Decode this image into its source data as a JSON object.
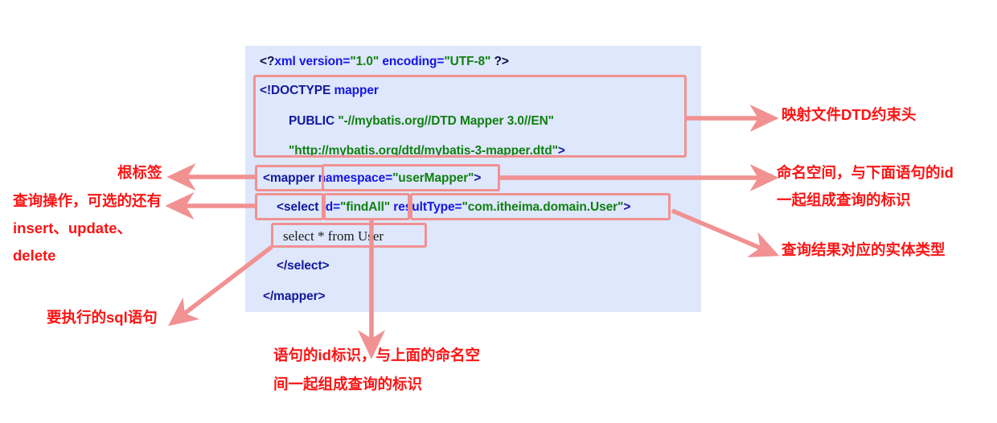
{
  "code_panel": {
    "background": "#dee7fb",
    "lines": [
      {
        "id": "xml-decl",
        "segments": [
          {
            "text": "<?",
            "color": "#0c0c4a"
          },
          {
            "text": "xml version=",
            "color": "#1515e8"
          },
          {
            "text": "\"1.0\"",
            "color": "#118011"
          },
          {
            "text": " ",
            "color": "#0c0c4a"
          },
          {
            "text": "encoding=",
            "color": "#1515e8"
          },
          {
            "text": "\"UTF-8\"",
            "color": "#118011"
          },
          {
            "text": " ?>",
            "color": "#0c0c4a"
          }
        ],
        "plain": "<?xml version=\"1.0\" encoding=\"UTF-8\" ?>"
      },
      {
        "id": "doctype",
        "segments": [
          {
            "text": "<!DOCTYPE ",
            "color": "#12199c"
          },
          {
            "text": "mapper",
            "color": "#1515e8"
          }
        ],
        "plain": "<!DOCTYPE mapper"
      },
      {
        "id": "doctype-public",
        "segments": [
          {
            "text": "PUBLIC ",
            "color": "#12199c"
          },
          {
            "text": "\"-//mybatis.org//DTD Mapper 3.0//EN\"",
            "color": "#118011"
          }
        ],
        "plain": "PUBLIC \"-//mybatis.org//DTD Mapper 3.0//EN\""
      },
      {
        "id": "doctype-system",
        "segments": [
          {
            "text": "\"http://mybatis.org/dtd/mybatis-3-mapper.dtd\"",
            "color": "#118011"
          },
          {
            "text": ">",
            "color": "#12199c"
          }
        ],
        "plain": "\"http://mybatis.org/dtd/mybatis-3-mapper.dtd\">"
      },
      {
        "id": "mapper-open",
        "segments": [
          {
            "text": "<mapper ",
            "color": "#12199c"
          },
          {
            "text": "namespace=",
            "color": "#1515e8"
          },
          {
            "text": "\"userMapper\"",
            "color": "#118011"
          },
          {
            "text": ">",
            "color": "#12199c"
          }
        ],
        "plain": "<mapper namespace=\"userMapper\">"
      },
      {
        "id": "select-open",
        "segments": [
          {
            "text": "<select ",
            "color": "#12199c"
          },
          {
            "text": "id=",
            "color": "#1515e8"
          },
          {
            "text": "\"findAll\"",
            "color": "#118011"
          },
          {
            "text": " ",
            "color": "#12199c"
          },
          {
            "text": "resultType=",
            "color": "#1515e8"
          },
          {
            "text": "\"com.itheima.domain.User\"",
            "color": "#118011"
          },
          {
            "text": ">",
            "color": "#12199c"
          }
        ],
        "plain": "<select id=\"findAll\" resultType=\"com.itheima.domain.User\">"
      },
      {
        "id": "sql-body",
        "segments": [
          {
            "text": "select * from User",
            "color": "#1a1a1a"
          }
        ],
        "plain": "select * from User"
      },
      {
        "id": "select-close",
        "segments": [
          {
            "text": "</select>",
            "color": "#12199c"
          }
        ],
        "plain": "</select>"
      },
      {
        "id": "mapper-close",
        "segments": [
          {
            "text": "</mapper>",
            "color": "#12199c"
          }
        ],
        "plain": "</mapper>"
      }
    ]
  },
  "highlights": {
    "accent_color": "#f19191",
    "boxes": [
      {
        "name": "doctype-highlight",
        "target": "DOCTYPE declaration block"
      },
      {
        "name": "mapper-tag-highlight",
        "target": "<mapper"
      },
      {
        "name": "namespace-highlight",
        "target": "namespace=\"userMapper\""
      },
      {
        "name": "select-tag-highlight",
        "target": "<select"
      },
      {
        "name": "id-highlight",
        "target": "id=\"findAll\""
      },
      {
        "name": "resulttype-highlight",
        "target": "resultType=\"com.itheima.domain.User\""
      },
      {
        "name": "sql-highlight",
        "target": "select * from User"
      }
    ]
  },
  "annotations": {
    "color": "#fb1414",
    "dtd_header": "映射文件DTD约束头",
    "root_tag": "根标签",
    "namespace_line1": "命名空间，与下面语句的id",
    "namespace_line2": "一起组成查询的标识",
    "query_op_line1": "查询操作，可选的还有",
    "query_op_line2": "insert、update、",
    "query_op_line3": "delete",
    "result_type": "查询结果对应的实体类型",
    "sql_statement": "要执行的sql语句",
    "id_note_line1": "语句的id标识，与上面的命名空",
    "id_note_line2": "间一起组成查询的标识"
  }
}
